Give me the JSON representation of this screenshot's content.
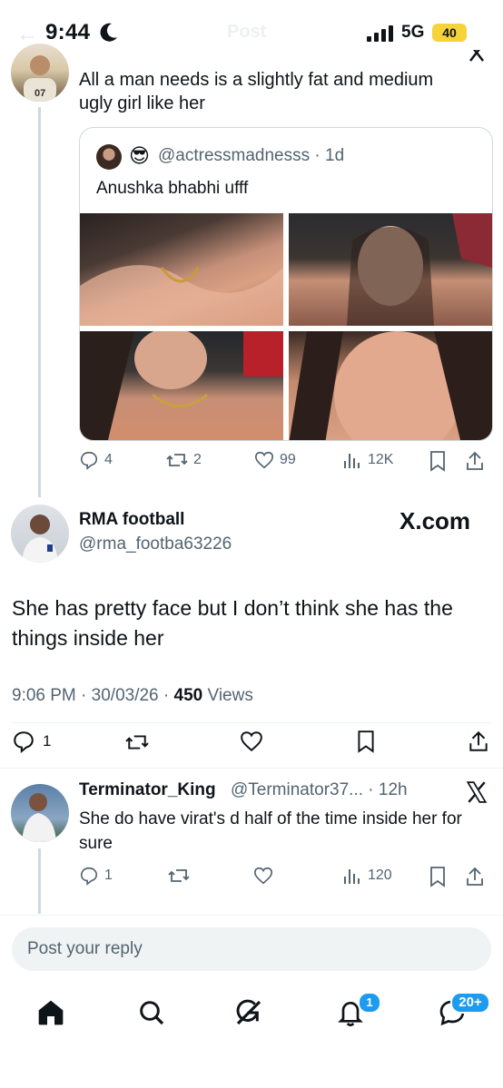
{
  "status_bar": {
    "time": "9:44",
    "network": "5G",
    "battery": "40"
  },
  "nav": {
    "title": "Post"
  },
  "parent_tweet": {
    "text": "All a man needs is a slightly fat and medium ugly girl like her",
    "quote": {
      "emoji": "😎",
      "handle": "@actressmadnesss",
      "time": "1d",
      "text": "Anushka bhabhi ufff"
    },
    "actions": {
      "replies": "4",
      "reposts": "2",
      "likes": "99",
      "views": "12K"
    }
  },
  "main_tweet": {
    "name": "RMA football",
    "handle": "@rma_footba63226",
    "watermark": "X.com",
    "text": "She has pretty face but I don’t think she has the things inside her",
    "time": "9:06 PM",
    "date": "30/03/26",
    "views_count": "450",
    "views_label": "Views",
    "actions": {
      "replies": "1"
    }
  },
  "reply_tweet": {
    "name": "Terminator_King",
    "handle": "@Terminator37...",
    "time": "12h",
    "text": "She do have virat's d half of the time inside her for sure",
    "actions": {
      "replies": "1",
      "views": "120"
    }
  },
  "reply_input": {
    "placeholder": "Post your reply"
  },
  "bottom_nav": {
    "notifications_badge": "1",
    "messages_badge": "20+"
  },
  "colors": {
    "accent": "#1d9bf0",
    "secondary_text": "#536471",
    "border": "#cfd9de",
    "battery": "#f5d33b"
  }
}
